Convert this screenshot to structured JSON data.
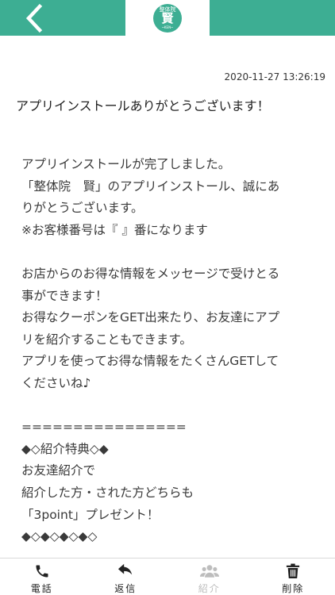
{
  "header": {
    "logo_line1": "整体院",
    "logo_line2": "賢",
    "logo_line3": "~KEN~"
  },
  "message": {
    "timestamp": "2020-11-27 13:26:19",
    "subject": "アプリインストールありがとうございます！",
    "lines": [
      "アプリインストールが完了しました。",
      "「整体院　賢」のアプリインストール、誠にあ",
      "りがとうございます。",
      "※お客様番号は『 』番になります",
      "",
      "お店からのお得な情報をメッセージで受けとる",
      "事ができます！",
      "お得なクーポンをGET出来たり、お友達にアプ",
      "リを紹介することもできます。",
      "アプリを使ってお得な情報をたくさんGETして",
      "くださいね♪",
      "",
      "================",
      "◆◇紹介特典◇◆",
      "お友達紹介で",
      "紹介した方・された方どちらも",
      "「3point」プレゼント！",
      "◆◇◆◇◆◇◆◇"
    ]
  },
  "tabbar": {
    "phone_label": "電話",
    "reply_label": "返信",
    "refer_label": "紹介",
    "delete_label": "削除"
  },
  "colors": {
    "brand": "#3dae93",
    "disabled": "#bdbdbd"
  }
}
